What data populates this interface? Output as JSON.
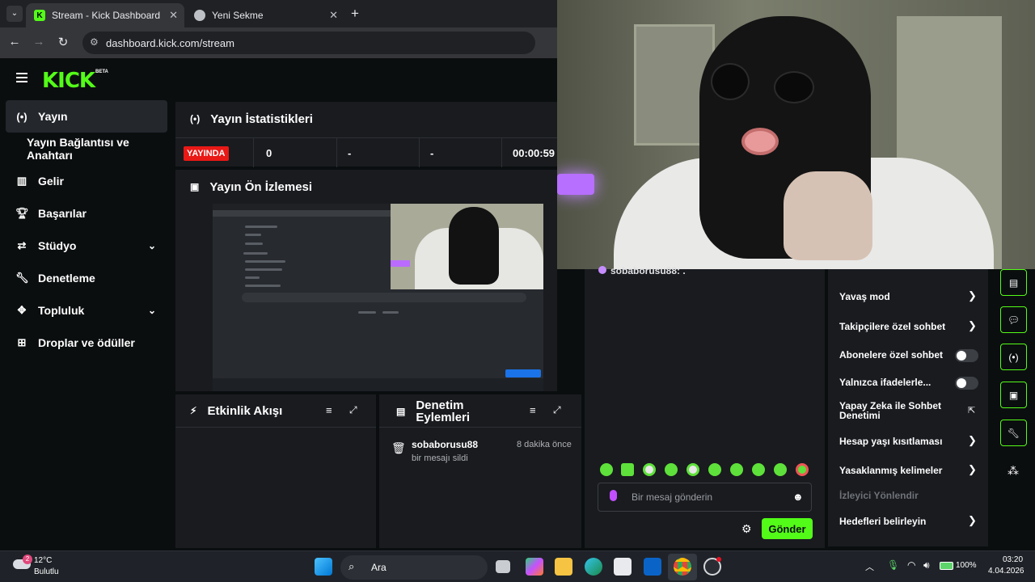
{
  "browser": {
    "tabs": [
      {
        "title": "Stream - Kick Dashboard",
        "active": true
      },
      {
        "title": "Yeni Sekme",
        "active": false
      }
    ],
    "url": "dashboard.kick.com/stream"
  },
  "header": {
    "logo": "KICK",
    "beta": "BETA"
  },
  "sidebar": {
    "items": [
      {
        "label": "Yayın",
        "icon": "broadcast-icon",
        "active": true
      },
      {
        "label": "Yayın Bağlantısı ve Anahtarı",
        "sub": true
      },
      {
        "label": "Gelir",
        "icon": "chart-icon"
      },
      {
        "label": "Başarılar",
        "icon": "trophy-icon"
      },
      {
        "label": "Stüdyo",
        "icon": "studio-icon",
        "expandable": true
      },
      {
        "label": "Denetleme",
        "icon": "wrench-icon"
      },
      {
        "label": "Topluluk",
        "icon": "community-icon",
        "expandable": true
      },
      {
        "label": "Droplar ve ödüller",
        "icon": "drops-icon"
      }
    ]
  },
  "stats": {
    "title": "Yayın İstatistikleri",
    "live_badge": "YAYINDA",
    "viewers": "0",
    "followers": "-",
    "subs": "-",
    "duration": "00:00:59"
  },
  "preview": {
    "title": "Yayın Ön İzlemesi"
  },
  "activity": {
    "title": "Etkinlik Akışı"
  },
  "mod_actions": {
    "title_line1": "Denetim",
    "title_line2": "Eylemleri",
    "entry": {
      "user": "sobaborusu88",
      "time": "8 dakika önce",
      "action": "bir mesajı sildi"
    }
  },
  "chat": {
    "message_user": "sobaborusu88:",
    "message_text": ".",
    "placeholder": "Bir mesaj gönderin",
    "send_label": "Gönder"
  },
  "mod_settings": {
    "slow_mode": "Yavaş mod",
    "followers_only": "Takipçilere özel sohbet",
    "subscribers_only": "Abonelere özel sohbet",
    "emotes_only": "Yalnızca ifadelerle...",
    "ai_moderation_line1": "Yapay Zeka ile Sohbet",
    "ai_moderation_line2": "Denetimi",
    "account_age": "Hesap yaşı kısıtlaması",
    "banned_words": "Yasaklanmış kelimeler",
    "viewer_directed": "İzleyici Yönlendir",
    "set_goals": "Hedefleri belirleyin"
  },
  "taskbar": {
    "weather_temp": "12°C",
    "weather_desc": "Bulutlu",
    "weather_badge": "2",
    "search_label": "Ara",
    "battery": "100%",
    "time": "03:20",
    "date": "4.04.2026"
  },
  "colors": {
    "brand": "#53fc18",
    "live": "#e91916",
    "panel": "#191b1f",
    "background": "#0b0e0f"
  }
}
